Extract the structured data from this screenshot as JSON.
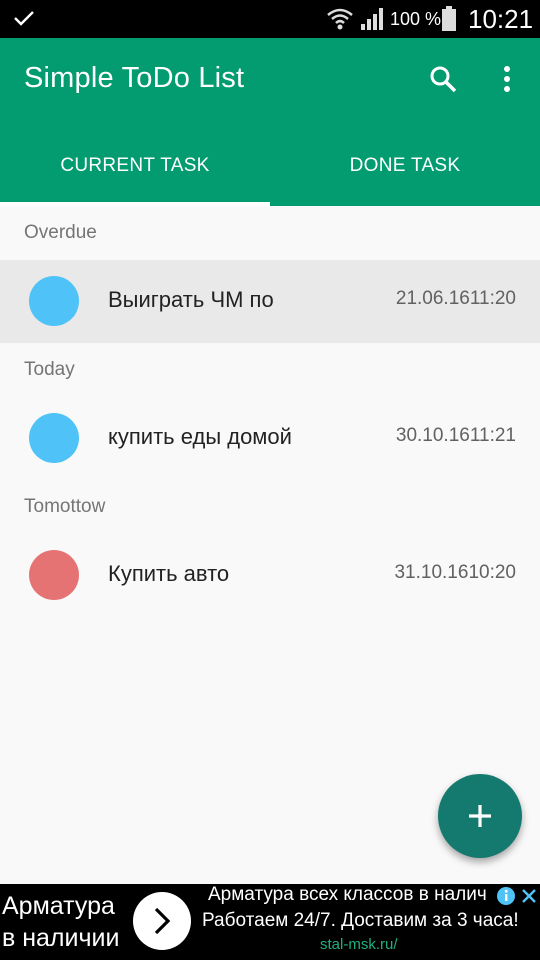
{
  "status_bar": {
    "battery_percent": "100 %",
    "time": "10:21",
    "icons": [
      "check-icon",
      "wifi-icon",
      "signal-icon",
      "battery-icon"
    ]
  },
  "app_bar": {
    "title": "Simple ToDo List",
    "icons": [
      "search-icon",
      "more-vert-icon"
    ],
    "tabs": [
      {
        "label": "CURRENT TASK",
        "active": true
      },
      {
        "label": "DONE TASK",
        "active": false
      }
    ]
  },
  "sections": [
    {
      "header": "Overdue",
      "tasks": [
        {
          "name": "Выиграть ЧМ по",
          "datetime": "21.06.1611:20",
          "color": "#4fc3f7",
          "selected": true
        }
      ]
    },
    {
      "header": "Today",
      "tasks": [
        {
          "name": "купить еды домой",
          "datetime": "30.10.1611:21",
          "color": "#4fc3f7",
          "selected": false
        }
      ]
    },
    {
      "header": "Tomottow",
      "tasks": [
        {
          "name": "Купить авто",
          "datetime": "31.10.1610:20",
          "color": "#e57373",
          "selected": false
        }
      ]
    }
  ],
  "fab": {
    "icon": "plus-icon",
    "color": "#14796e"
  },
  "ad": {
    "headline_1": "Арматура",
    "headline_2": "в наличии",
    "text_1": "Арматура всех классов в налич",
    "text_2": "Работаем 24/7. Доставим за 3 часа!",
    "url": "stal-msk.ru/",
    "icons": [
      "chevron-right-icon",
      "info-icon",
      "close-icon"
    ]
  },
  "colors": {
    "primary": "#039b70",
    "accent": "#14796e",
    "background": "#f9f9f9"
  }
}
